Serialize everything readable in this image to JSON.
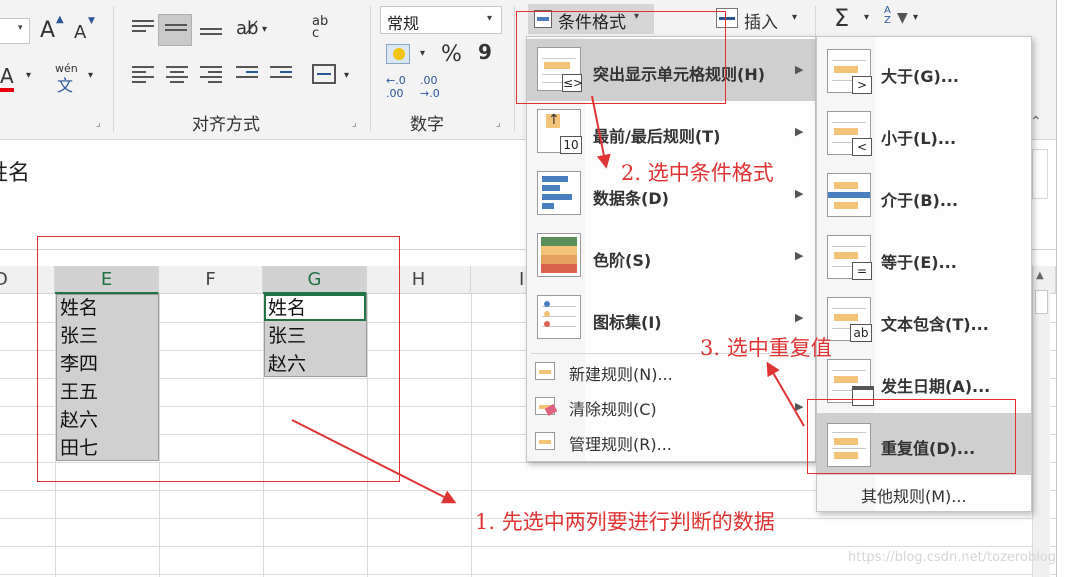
{
  "ribbon": {
    "font_group": {
      "grow_label": "A",
      "shrink_label": "A",
      "font_color_label": "A",
      "wen_label": "wén",
      "wen_char": "文"
    },
    "alignment_group": {
      "label": "对齐方式",
      "wrap_label": "ab c"
    },
    "number_group": {
      "label": "数字",
      "format_value": "常规",
      "percent": "%",
      "comma": "9",
      "inc_decimal": "←.0 .00",
      "dec_decimal": ".00 →.0"
    },
    "styles": {
      "conditional_format_label": "条件格式",
      "dropdown_caret": "▾"
    },
    "cells": {
      "insert_label": "插入"
    },
    "editing": {
      "sum_label": "Σ",
      "sort_label": "A Z"
    }
  },
  "formula_bar": {
    "content": "姓名"
  },
  "sheet": {
    "columns": [
      "D",
      "E",
      "F",
      "G",
      "H",
      "I"
    ],
    "col_e_values": [
      "姓名",
      "张三",
      "李四",
      "王五",
      "赵六",
      "田七"
    ],
    "col_g_values": [
      "姓名",
      "张三",
      "赵六"
    ]
  },
  "cond_menu": {
    "items": [
      {
        "label": "突出显示单元格规则(H)",
        "underline": "H"
      },
      {
        "label": "最前/最后规则(T)",
        "underline": "T"
      },
      {
        "label": "数据条(D)",
        "underline": "D"
      },
      {
        "label": "色阶(S)",
        "underline": "S"
      },
      {
        "label": "图标集(I)",
        "underline": "I"
      }
    ],
    "small_items": [
      {
        "label": "新建规则(N)..."
      },
      {
        "label": "清除规则(C)"
      },
      {
        "label": "管理规则(R)..."
      }
    ],
    "top10_badge": "10",
    "highlight_badge": "≤>"
  },
  "sub_menu": {
    "items": [
      {
        "label": "大于(G)...",
        "badge": ">"
      },
      {
        "label": "小于(L)...",
        "badge": "<"
      },
      {
        "label": "介于(B)...",
        "badge": ""
      },
      {
        "label": "等于(E)...",
        "badge": "="
      },
      {
        "label": "文本包含(T)...",
        "badge": "ab"
      },
      {
        "label": "发生日期(A)...",
        "badge": ""
      },
      {
        "label": "重复值(D)...",
        "badge": ""
      }
    ],
    "other_rules": "其他规则(M)..."
  },
  "annotations": {
    "step1": "1. 先选中两列要进行判断的数据",
    "step2": "2. 选中条件格式",
    "step3": "3. 选中重复值"
  },
  "watermark": "https://blog.csdn.net/tozeroblog",
  "colors": {
    "annotation_red": "#e03434",
    "highlight_bar": "#f3c37a",
    "excel_green": "#217346"
  }
}
